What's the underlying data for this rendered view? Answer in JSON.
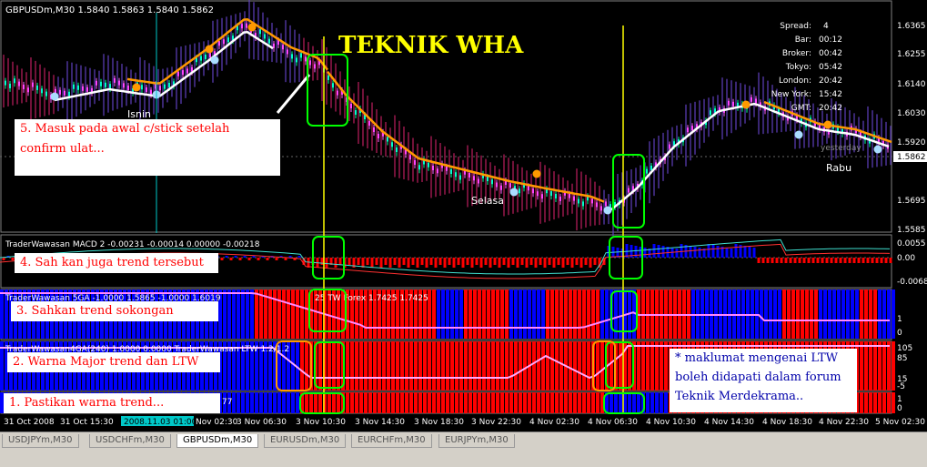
{
  "chart_title": "GBPUSDm,M30  1.5840 1.5863 1.5840 1.5862",
  "headline": "TEKNIK WHA",
  "price_labels": [
    "1.6365",
    "1.6255",
    "1.6140",
    "1.6030",
    "1.5920",
    "1.5695",
    "1.5585"
  ],
  "current_price": "1.5862",
  "info_panel": [
    {
      "label": "Spread:",
      "value": "4"
    },
    {
      "label": "Bar:",
      "value": "00:12"
    },
    {
      "label": "Broker:",
      "value": "00:42"
    },
    {
      "label": "Tokyo:",
      "value": "05:42"
    },
    {
      "label": "London:",
      "value": "20:42"
    },
    {
      "label": "New York:",
      "value": "15:42"
    },
    {
      "label": "GMT:",
      "value": "20:42"
    }
  ],
  "day_labels": {
    "isnin": "Isnin",
    "selasa": "Selasa",
    "rabu": "Rabu",
    "yesterday": "yesterday"
  },
  "panels": {
    "macd": {
      "title": "TraderWawasan MACD 2 -0.00231 -0.00014 0.00000 -0.00218",
      "levels": [
        "0.0055",
        "0.00",
        "-0.00687"
      ]
    },
    "sga": {
      "title": "TraderWawasan 5GA -1.0000 1.5865 -1.0000 1.6019",
      "title2": "25  TW Forex 1.7425 1.7425",
      "levels": [
        "1",
        "0"
      ]
    },
    "ga4": {
      "title": "TraderWawasan4GA(240) 1.0000 0.0000  TraderWawasan LTW 1.2/1.2",
      "levels": [
        "105",
        "85",
        "15",
        "-5"
      ]
    },
    "trend": {
      "title": "77",
      "levels": [
        "1",
        "0"
      ]
    }
  },
  "time_labels": [
    "31 Oct 2008",
    "31 Oct 15:30",
    "2008.11.03 01:00",
    "Nov 02:30",
    "3 Nov 06:30",
    "3 Nov 10:30",
    "3 Nov 14:30",
    "3 Nov 18:30",
    "3 Nov 22:30",
    "4 Nov 02:30",
    "4 Nov 06:30",
    "4 Nov 10:30",
    "4 Nov 14:30",
    "4 Nov 18:30",
    "4 Nov 22:30",
    "5 Nov 02:30"
  ],
  "notes": {
    "n5": "5. Masuk pada awal c/stick setelah confirm ulat...",
    "n4": "4. Sah kan juga trend tersebut",
    "n3": "3. Sahkan trend sokongan",
    "n2": "2. Warna Major trend dan LTW",
    "n1": "1. Pastikan warna trend...",
    "maklumat": "* maklumat mengenai LTW boleh didapati dalam forum Teknik Merdekrama.."
  },
  "tabs": [
    "USDJPYm,M30",
    "USDCHFm,M30",
    "GBPUSDm,M30",
    "EURUSDm,M30",
    "EURCHFm,M30",
    "EURJPYm,M30"
  ],
  "active_tab": "GBPUSDm,M30",
  "colors": {
    "bull": "#0000ff",
    "bear": "#ff0000",
    "orange": "#ff9900",
    "marker": "#00ff00",
    "vline": "#ffff00"
  }
}
